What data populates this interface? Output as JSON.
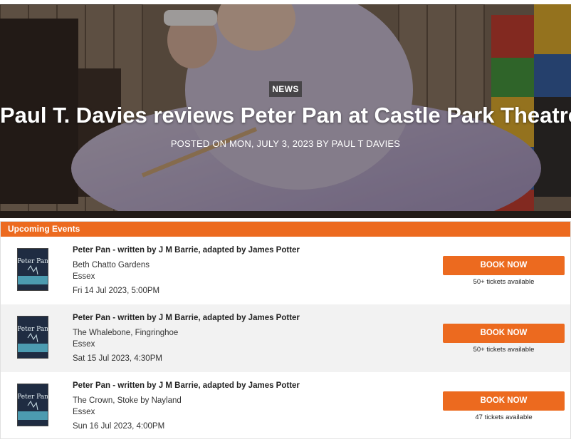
{
  "hero": {
    "category": "NEWS",
    "title": "Paul T. Davies reviews Peter Pan at Castle Park Theatre.",
    "meta": "POSTED ON MON, JULY 3, 2023 BY PAUL T DAVIES"
  },
  "upcoming": {
    "heading": "Upcoming Events",
    "poster_text": "Peter Pan",
    "events": [
      {
        "title": "Peter Pan - written by J M Barrie, adapted by James Potter",
        "venue": "Beth Chatto Gardens",
        "county": "Essex",
        "date": "Fri 14 Jul 2023, 5:00PM",
        "button": "BOOK NOW",
        "tickets": "50+ tickets available"
      },
      {
        "title": "Peter Pan - written by J M Barrie, adapted by James Potter",
        "venue": "The Whalebone, Fingringhoe",
        "county": "Essex",
        "date": "Sat 15 Jul 2023, 4:30PM",
        "button": "BOOK NOW",
        "tickets": "50+ tickets available"
      },
      {
        "title": "Peter Pan - written by J M Barrie, adapted by James Potter",
        "venue": "The Crown, Stoke by Nayland",
        "county": "Essex",
        "date": "Sun 16 Jul 2023, 4:00PM",
        "button": "BOOK NOW",
        "tickets": "47 tickets available"
      }
    ]
  },
  "colors": {
    "accent": "#ec6a1f",
    "alt_row": "#f2f2f2"
  }
}
